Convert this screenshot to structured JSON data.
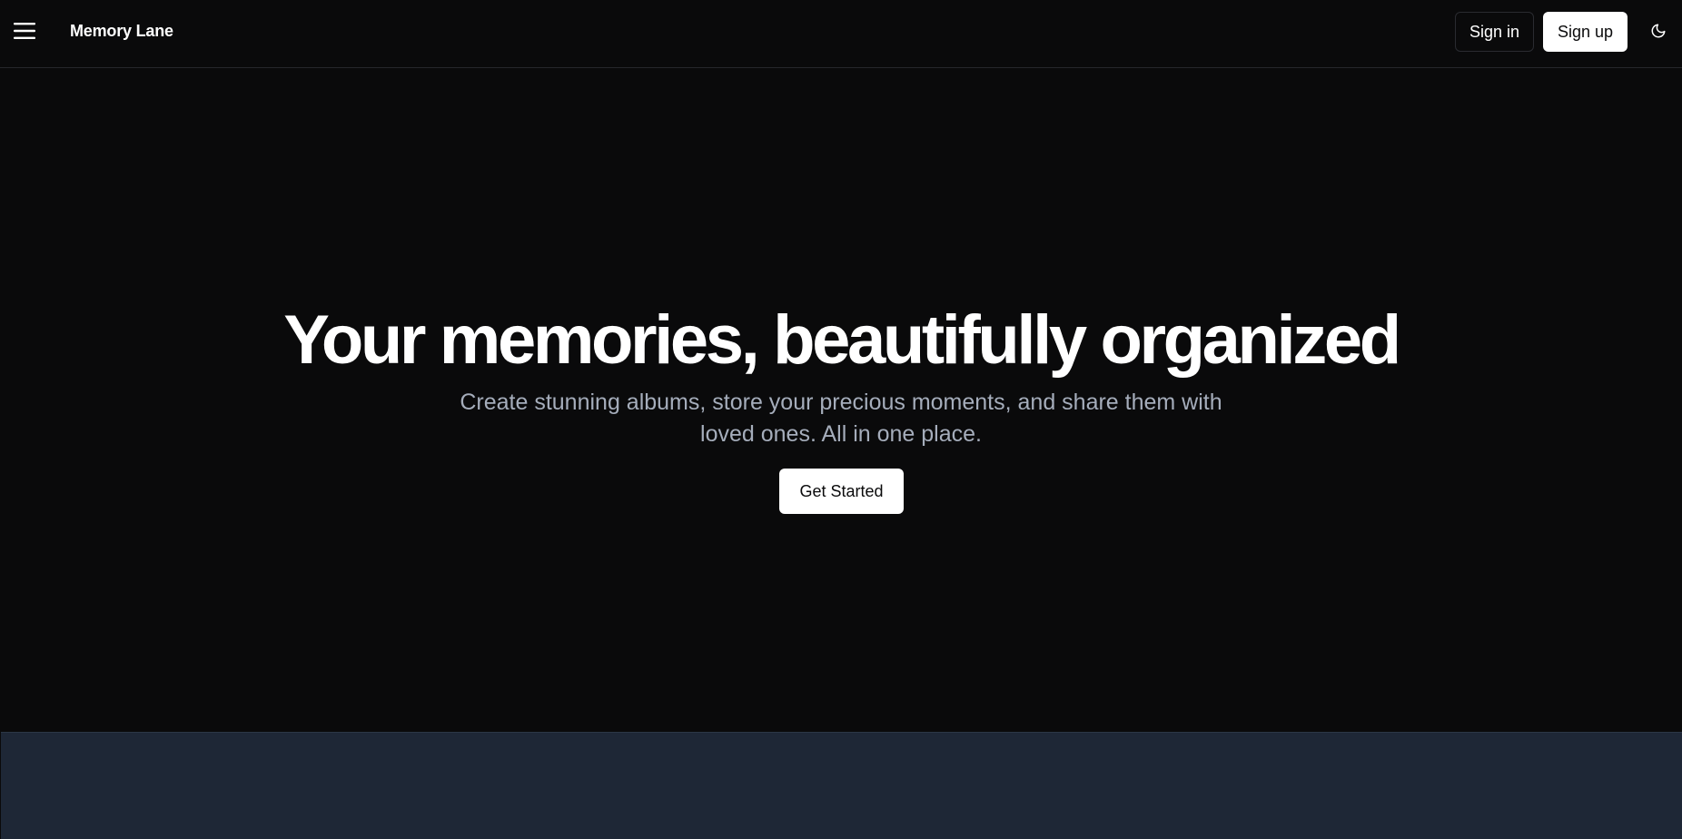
{
  "header": {
    "menu_icon": "hamburger-menu-icon",
    "brand": "Memory Lane",
    "sign_in_label": "Sign in",
    "sign_up_label": "Sign up",
    "theme_icon": "moon-icon"
  },
  "hero": {
    "title": "Your memories, beautifully organized",
    "subtitle": "Create stunning albums, store your precious moments, and share them with loved ones. All in one place.",
    "cta_label": "Get Started"
  },
  "colors": {
    "background": "#0a0a0b",
    "text": "#ffffff",
    "muted_text": "#a5adbb",
    "bottom_section": "#1e2736"
  }
}
